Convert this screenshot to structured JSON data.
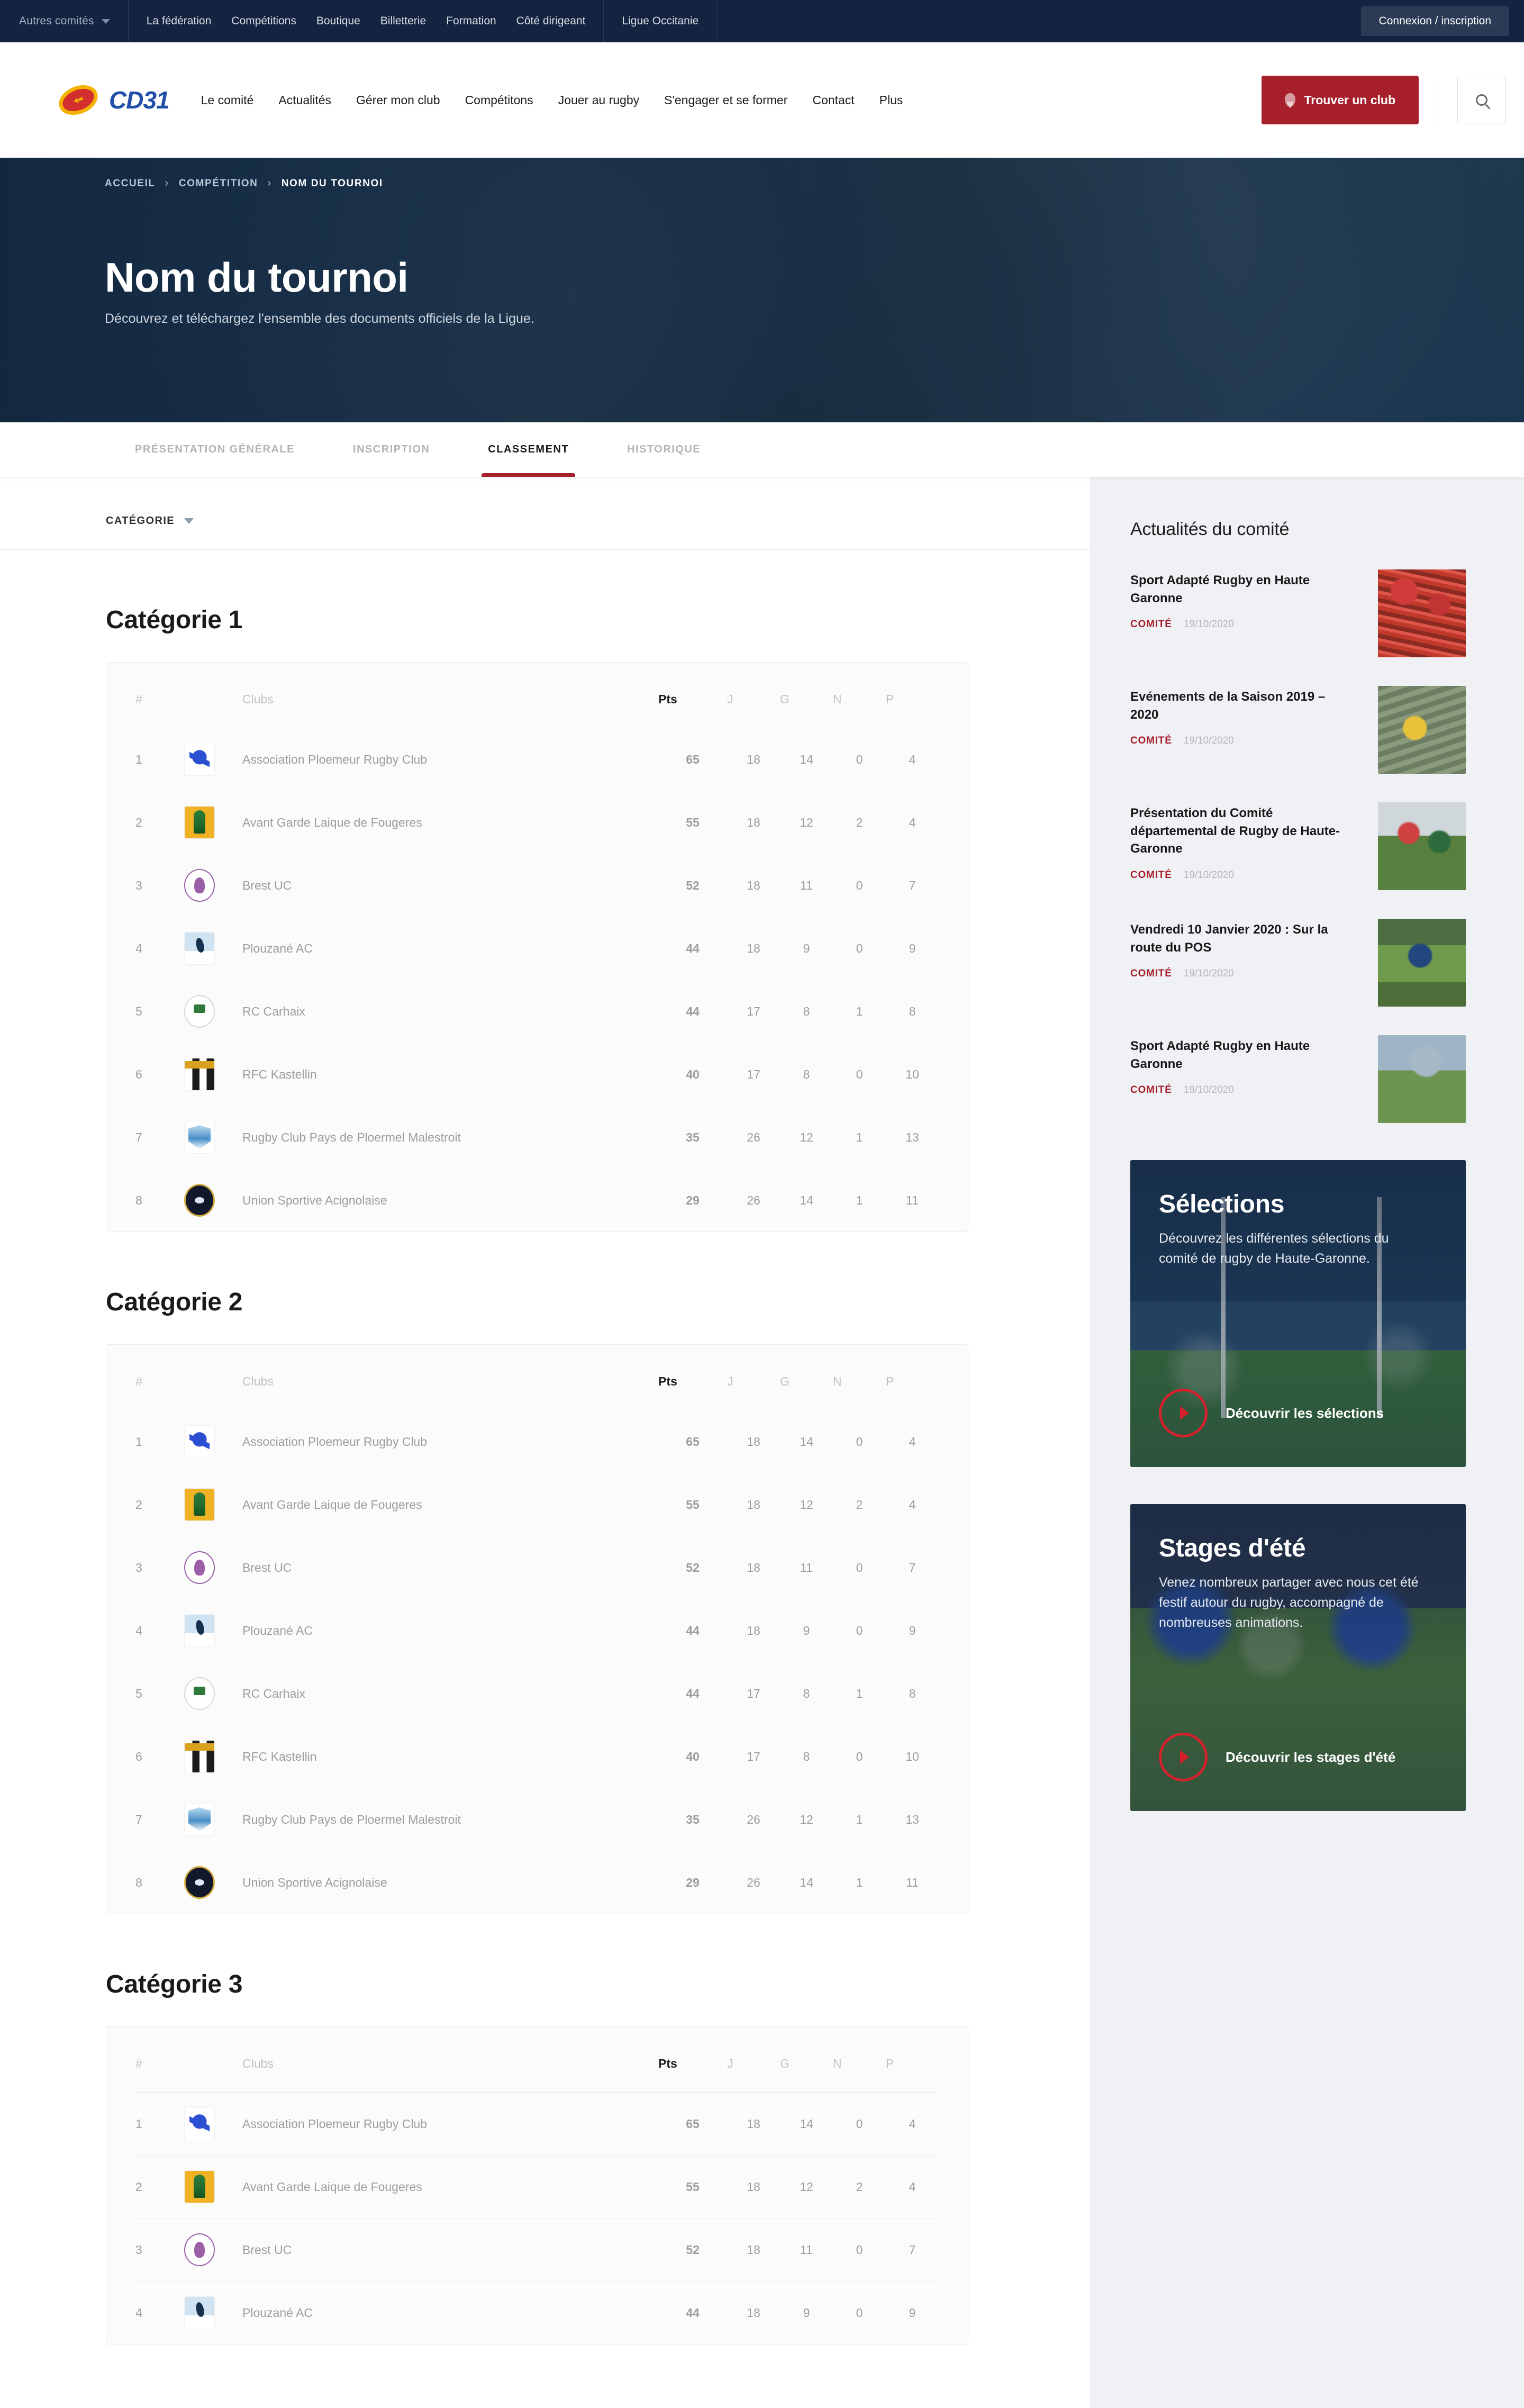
{
  "topbar": {
    "committees_label": "Autres comités",
    "links": [
      "La fédération",
      "Compétitions",
      "Boutique",
      "Billetterie",
      "Formation",
      "Côté dirigeant"
    ],
    "league": "Ligue Occitanie",
    "login": "Connexion / inscription"
  },
  "header": {
    "brand": "CD31",
    "nav": [
      "Le comité",
      "Actualités",
      "Gérer mon club",
      "Compétitons",
      "Jouer au rugby",
      "S'engager et se former",
      "Contact",
      "Plus"
    ],
    "find_club": "Trouver un club"
  },
  "hero": {
    "breadcrumb": [
      "ACCUEIL",
      "COMPÉTITION",
      "NOM DU TOURNOI"
    ],
    "title": "Nom du tournoi",
    "subtitle": "Découvrez et téléchargez l'ensemble des documents officiels de la Ligue."
  },
  "tabs": [
    {
      "label": "PRÉSENTATION GÉNÉRALE",
      "active": false
    },
    {
      "label": "INSCRIPTION",
      "active": false
    },
    {
      "label": "CLASSEMENT",
      "active": true
    },
    {
      "label": "HISTORIQUE",
      "active": false
    }
  ],
  "filter": {
    "label": "CATÉGORIE"
  },
  "table_headers": [
    "#",
    "Clubs",
    "Pts",
    "J",
    "G",
    "N",
    "P"
  ],
  "categories": [
    {
      "title": "Catégorie 1",
      "rows": [
        {
          "rank": "1",
          "club": "Association Ploemeur Rugby Club",
          "logo": "l-ploemeur",
          "pts": "65",
          "j": "18",
          "g": "14",
          "n": "0",
          "p": "4"
        },
        {
          "rank": "2",
          "club": "Avant Garde Laique de Fougeres",
          "logo": "l-fougeres",
          "pts": "55",
          "j": "18",
          "g": "12",
          "n": "2",
          "p": "4"
        },
        {
          "rank": "3",
          "club": "Brest UC",
          "logo": "l-brest",
          "pts": "52",
          "j": "18",
          "g": "11",
          "n": "0",
          "p": "7"
        },
        {
          "rank": "4",
          "club": "Plouzané AC",
          "logo": "l-plouzane",
          "pts": "44",
          "j": "18",
          "g": "9",
          "n": "0",
          "p": "9"
        },
        {
          "rank": "5",
          "club": "RC Carhaix",
          "logo": "l-carhaix",
          "pts": "44",
          "j": "17",
          "g": "8",
          "n": "1",
          "p": "8"
        },
        {
          "rank": "6",
          "club": "RFC Kastellin",
          "logo": "l-kastellin",
          "pts": "40",
          "j": "17",
          "g": "8",
          "n": "0",
          "p": "10"
        },
        {
          "rank": "7",
          "club": "Rugby Club Pays de Ploermel Malestroit",
          "logo": "l-ploermel",
          "pts": "35",
          "j": "26",
          "g": "12",
          "n": "1",
          "p": "13"
        },
        {
          "rank": "8",
          "club": "Union Sportive Acignolaise",
          "logo": "l-acignolaise",
          "pts": "29",
          "j": "26",
          "g": "14",
          "n": "1",
          "p": "11"
        }
      ]
    },
    {
      "title": "Catégorie 2",
      "rows": [
        {
          "rank": "1",
          "club": "Association Ploemeur Rugby Club",
          "logo": "l-ploemeur",
          "pts": "65",
          "j": "18",
          "g": "14",
          "n": "0",
          "p": "4"
        },
        {
          "rank": "2",
          "club": "Avant Garde Laique de Fougeres",
          "logo": "l-fougeres",
          "pts": "55",
          "j": "18",
          "g": "12",
          "n": "2",
          "p": "4"
        },
        {
          "rank": "3",
          "club": "Brest UC",
          "logo": "l-brest",
          "pts": "52",
          "j": "18",
          "g": "11",
          "n": "0",
          "p": "7"
        },
        {
          "rank": "4",
          "club": "Plouzané AC",
          "logo": "l-plouzane",
          "pts": "44",
          "j": "18",
          "g": "9",
          "n": "0",
          "p": "9"
        },
        {
          "rank": "5",
          "club": "RC Carhaix",
          "logo": "l-carhaix",
          "pts": "44",
          "j": "17",
          "g": "8",
          "n": "1",
          "p": "8"
        },
        {
          "rank": "6",
          "club": "RFC Kastellin",
          "logo": "l-kastellin",
          "pts": "40",
          "j": "17",
          "g": "8",
          "n": "0",
          "p": "10"
        },
        {
          "rank": "7",
          "club": "Rugby Club Pays de Ploermel Malestroit",
          "logo": "l-ploermel",
          "pts": "35",
          "j": "26",
          "g": "12",
          "n": "1",
          "p": "13"
        },
        {
          "rank": "8",
          "club": "Union Sportive Acignolaise",
          "logo": "l-acignolaise",
          "pts": "29",
          "j": "26",
          "g": "14",
          "n": "1",
          "p": "11"
        }
      ]
    },
    {
      "title": "Catégorie 3",
      "rows": [
        {
          "rank": "1",
          "club": "Association Ploemeur Rugby Club",
          "logo": "l-ploemeur",
          "pts": "65",
          "j": "18",
          "g": "14",
          "n": "0",
          "p": "4"
        },
        {
          "rank": "2",
          "club": "Avant Garde Laique de Fougeres",
          "logo": "l-fougeres",
          "pts": "55",
          "j": "18",
          "g": "12",
          "n": "2",
          "p": "4"
        },
        {
          "rank": "3",
          "club": "Brest UC",
          "logo": "l-brest",
          "pts": "52",
          "j": "18",
          "g": "11",
          "n": "0",
          "p": "7"
        },
        {
          "rank": "4",
          "club": "Plouzané AC",
          "logo": "l-plouzane",
          "pts": "44",
          "j": "18",
          "g": "9",
          "n": "0",
          "p": "9"
        }
      ]
    }
  ],
  "aside": {
    "news_title": "Actualités du comité",
    "news": [
      {
        "title": "Sport Adapté Rugby en Haute Garonne",
        "cat": "COMITÉ",
        "date": "19/10/2020",
        "thumb": "th1"
      },
      {
        "title": "Evénements de la Saison 2019 – 2020",
        "cat": "COMITÉ",
        "date": "19/10/2020",
        "thumb": "th2"
      },
      {
        "title": "Présentation du Comité départemental de Rugby de Haute-Garonne",
        "cat": "COMITÉ",
        "date": "19/10/2020",
        "thumb": "th3"
      },
      {
        "title": "Vendredi 10 Janvier 2020 : Sur la route du POS",
        "cat": "COMITÉ",
        "date": "19/10/2020",
        "thumb": "th4"
      },
      {
        "title": "Sport Adapté Rugby en Haute Garonne",
        "cat": "COMITÉ",
        "date": "19/10/2020",
        "thumb": "th5"
      }
    ],
    "promos": [
      {
        "title": "Sélections",
        "desc": "Découvrez les différentes sélections du comité de rugby de Haute-Garonne.",
        "cta": "Découvrir les sélections"
      },
      {
        "title": "Stages d'été",
        "desc": "Venez nombreux partager avec nous cet été festif autour du rugby, accompagné de nombreuses animations.",
        "cta": "Découvrir les stages d'été"
      }
    ]
  },
  "colors": {
    "navy": "#142440",
    "red": "#a61f2b",
    "accent_red": "#d4212c",
    "brand_blue": "#2250a8",
    "aside_bg": "#eff1f5"
  }
}
